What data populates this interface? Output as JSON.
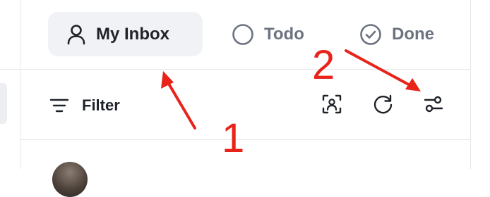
{
  "tabs": {
    "my_inbox": {
      "label": "My Inbox",
      "icon": "user-icon"
    },
    "todo": {
      "label": "Todo",
      "icon": "circle-icon"
    },
    "done": {
      "label": "Done",
      "icon": "check-circle-icon"
    }
  },
  "toolbar": {
    "filter_label": "Filter",
    "filter_icon": "filter-lines-icon",
    "buttons": [
      "scan-user-icon",
      "refresh-icon",
      "sliders-settings-icon"
    ]
  },
  "annotations": {
    "label_1": "1",
    "label_2": "2",
    "color": "#e8231a"
  },
  "colors": {
    "active_tab_bg": "#f1f2f5",
    "text_dark": "#1f2329",
    "text_muted": "#6b7280",
    "divider": "#e7e8ec"
  }
}
